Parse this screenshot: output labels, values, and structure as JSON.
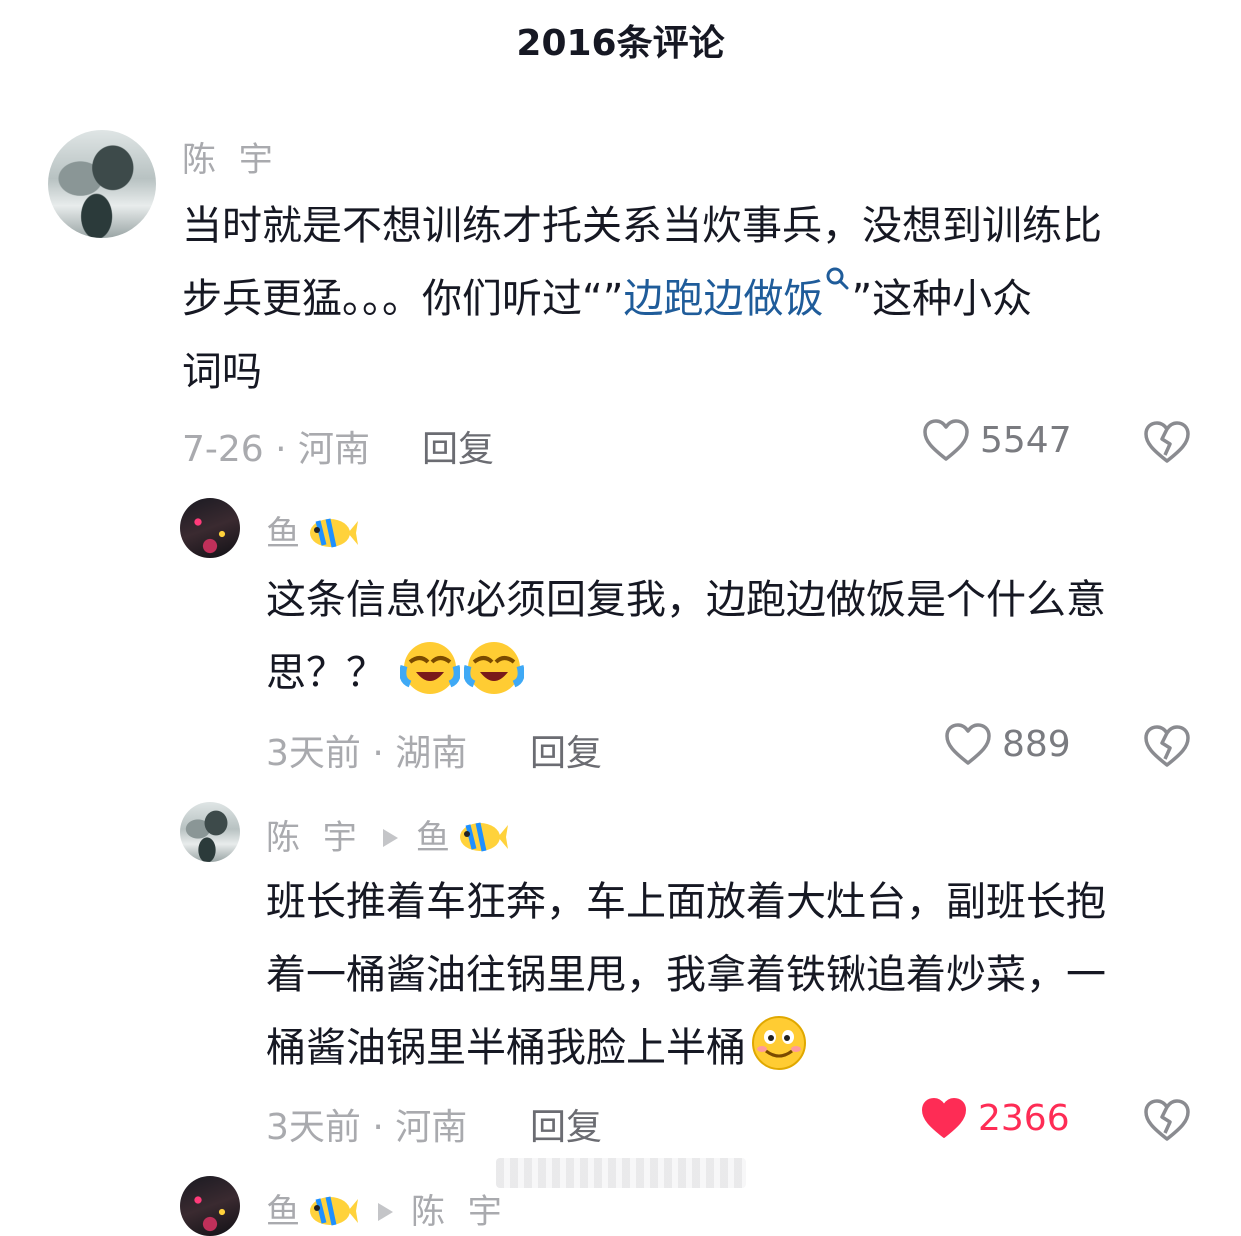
{
  "header": {
    "title": "2016条评论"
  },
  "comments": [
    {
      "username": "陈 宇",
      "content_line1": "当时就是不想训练才托关系当炊事兵，没想到训练比",
      "content_line2_before": "步兵更猛。。。你们听过“”",
      "content_link": "边跑边做饭",
      "content_line2_after": "”这种小众",
      "content_line3": "词吗",
      "meta": "7-26 · 河南",
      "reply_label": "回复",
      "likes": "5547",
      "liked": false
    }
  ],
  "replies": [
    {
      "username": "鱼",
      "username_emoji": "tropical-fish-icon",
      "content_line1": "这条信息你必须回复我，边跑边做饭是个什么意",
      "content_line2": "思？？",
      "content_emoji": "laughing-tears-icon",
      "meta": "3天前 · 湖南",
      "reply_label": "回复",
      "likes": "889",
      "liked": false
    },
    {
      "username": "陈 宇",
      "reply_to": "鱼",
      "content_line1": "班长推着车狂奔，车上面放着大灶台，副班长抱",
      "content_line2": "着一桶酱油往锅里甩，我拿着铁锹追着炒菜，一",
      "content_line3": "桶酱油锅里半桶我脸上半桶",
      "content_emoji": "smiling-face-icon",
      "meta": "3天前 · 河南",
      "reply_label": "回复",
      "likes": "2366",
      "liked": true
    },
    {
      "username": "鱼",
      "reply_to": "陈 宇"
    }
  ],
  "colors": {
    "accent_like": "#fe2c55",
    "link": "#1f5c9a",
    "muted": "#a9aaae"
  }
}
